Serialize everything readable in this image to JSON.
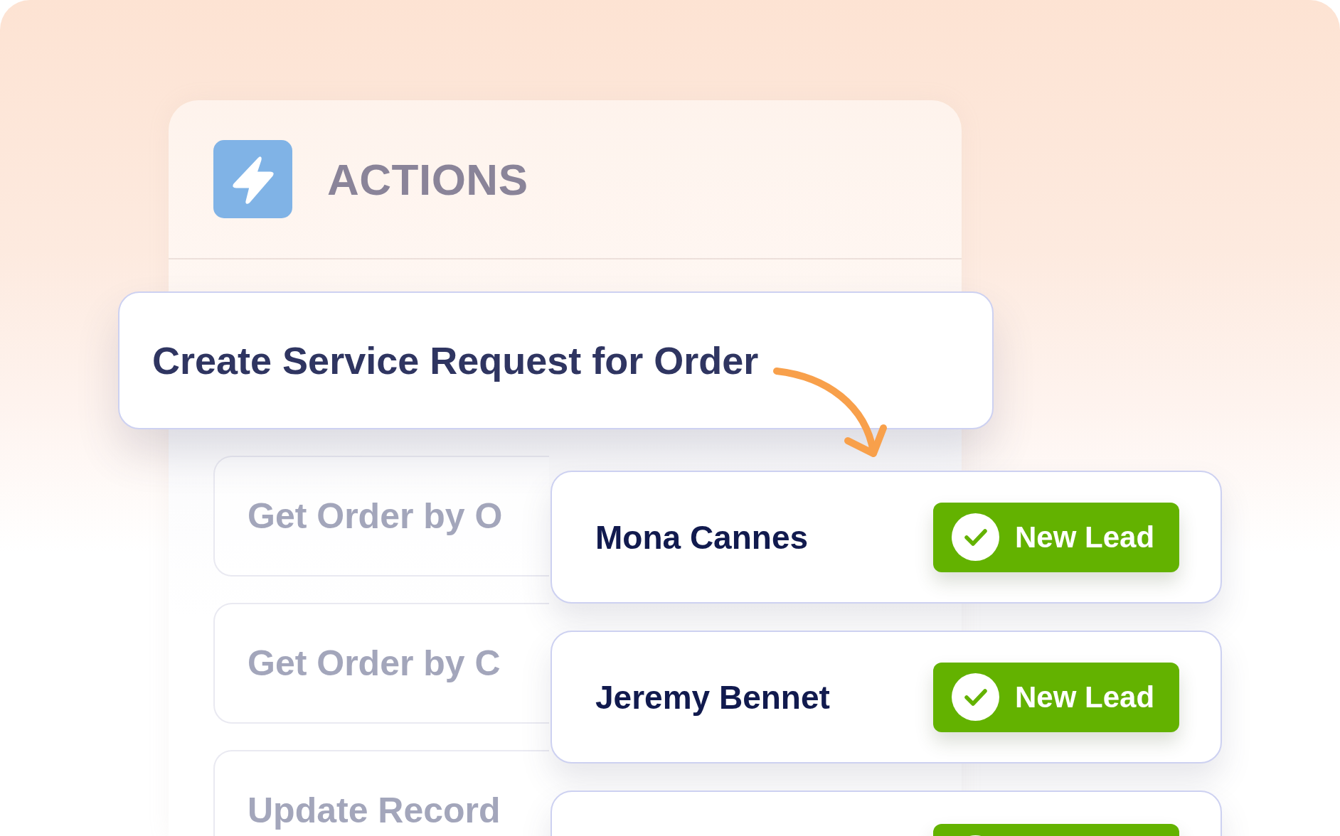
{
  "panel": {
    "title": "ACTIONS",
    "items": [
      {
        "label": "Get Order by O"
      },
      {
        "label": "Get Order by C"
      },
      {
        "label": "Update Record"
      }
    ]
  },
  "selected_action": {
    "label": "Create Service Request for Order"
  },
  "leads": [
    {
      "name": "Mona Cannes",
      "badge": {
        "color": "#63b200",
        "label": "New Lead"
      }
    },
    {
      "name": "Jeremy Bennet",
      "badge": {
        "color": "#63b200",
        "label": "New Lead"
      }
    },
    {
      "badge": {
        "color": "#63b200"
      }
    }
  ]
}
